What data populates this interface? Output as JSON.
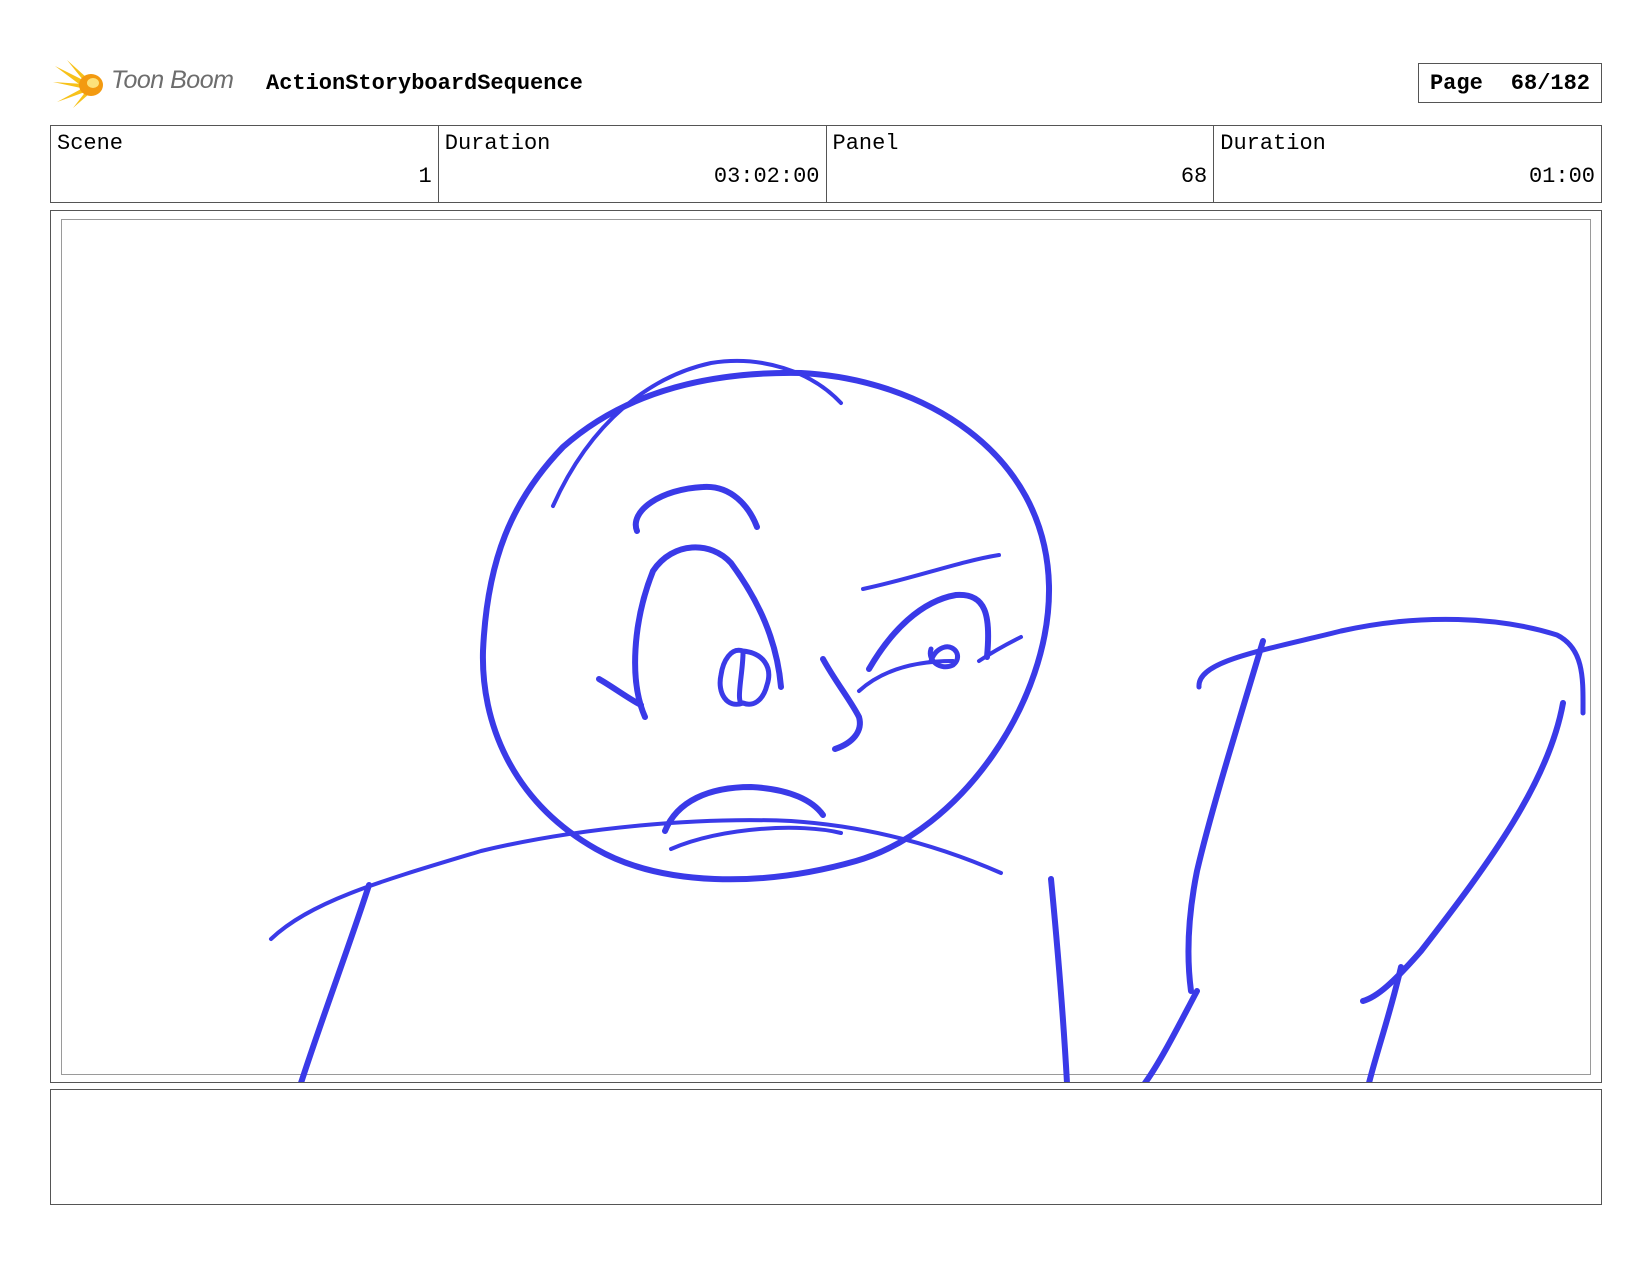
{
  "header": {
    "logo_text": "Toon Boom",
    "sequence_title": "ActionStoryboardSequence",
    "page_label": "Page",
    "page_value": "68/182"
  },
  "info": {
    "scene_label": "Scene",
    "scene_value": "1",
    "scene_duration_label": "Duration",
    "scene_duration_value": "03:02:00",
    "panel_label": "Panel",
    "panel_value": "68",
    "panel_duration_label": "Duration",
    "panel_duration_value": "01:00"
  },
  "panel": {
    "sketch_color": "#3a3ae8"
  },
  "caption": {
    "text": ""
  }
}
